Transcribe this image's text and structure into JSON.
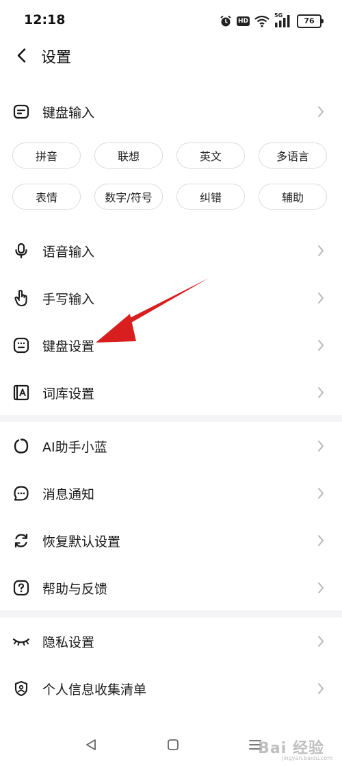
{
  "status_bar": {
    "time": "12:18",
    "network": "5G",
    "hd_badge": "HD",
    "battery": "76"
  },
  "header": {
    "title": "设置"
  },
  "keyboard_input": {
    "label": "键盘输入",
    "chips": [
      "拼音",
      "联想",
      "英文",
      "多语言",
      "表情",
      "数字/符号",
      "纠错",
      "辅助"
    ]
  },
  "menu_group_1": [
    {
      "label": "语音输入",
      "icon": "microphone-icon"
    },
    {
      "label": "手写输入",
      "icon": "hand-pointer-icon"
    },
    {
      "label": "键盘设置",
      "icon": "keyboard-icon"
    },
    {
      "label": "词库设置",
      "icon": "dictionary-icon"
    }
  ],
  "menu_group_2": [
    {
      "label": "AI助手小蓝",
      "icon": "ai-assistant-icon"
    },
    {
      "label": "消息通知",
      "icon": "message-icon"
    },
    {
      "label": "恢复默认设置",
      "icon": "restore-icon"
    },
    {
      "label": "帮助与反馈",
      "icon": "help-icon"
    }
  ],
  "menu_group_3": [
    {
      "label": "隐私设置",
      "icon": "eye-closed-icon"
    },
    {
      "label": "个人信息收集清单",
      "icon": "shield-user-icon"
    }
  ],
  "annotation": {
    "arrow_color": "#d81e1e"
  },
  "watermark": {
    "text": "Bai 经验",
    "sub": "jingyan.baidu.com"
  },
  "colors": {
    "text": "#1a1a1a",
    "chevron": "#b8b8b8",
    "divider": "#f4f4f6",
    "chip_border": "#dcdcdc"
  }
}
